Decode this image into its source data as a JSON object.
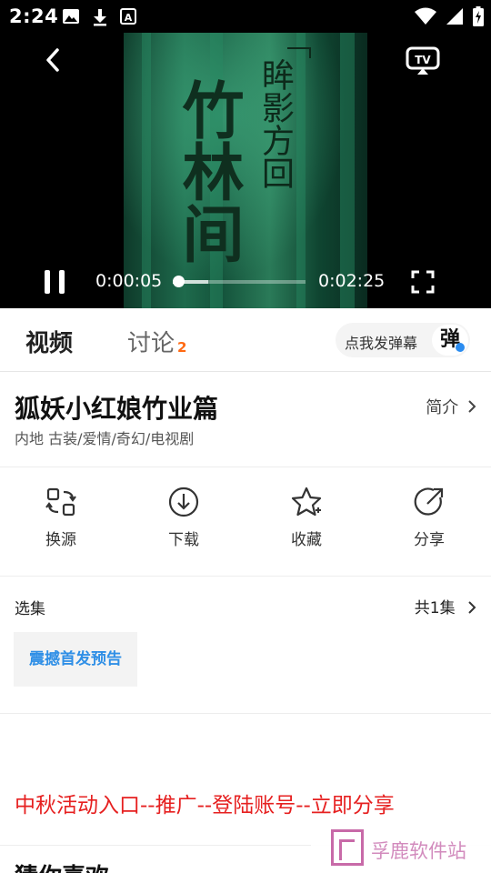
{
  "status_bar": {
    "time": "2:24",
    "left_icons": [
      "image-icon",
      "download-icon",
      "font-icon"
    ],
    "right_icons": [
      "wifi-icon",
      "signal-icon",
      "battery-charging-icon"
    ]
  },
  "player": {
    "poster": {
      "main_text": "竹林间",
      "side_text": "眸影方回"
    },
    "current_time": "0:00:05",
    "duration": "0:02:25",
    "progress": 0.04,
    "buffered": 0.27,
    "icons": {
      "back": "back-chevron-icon",
      "cast": "tv-cast-icon",
      "pause": "pause-icon",
      "fullscreen": "fullscreen-icon"
    }
  },
  "tabs": {
    "video": "视频",
    "discuss": "讨论",
    "discuss_count": "2",
    "danmu_label": "点我发弹幕",
    "danmu_icon": "弹"
  },
  "show": {
    "title": "狐妖小红娘竹业篇",
    "meta": "内地 古装/爱情/奇幻/电视剧",
    "intro_link": "简介"
  },
  "actions": [
    {
      "label": "换源",
      "icon": "switch-source-icon"
    },
    {
      "label": "下载",
      "icon": "download-icon"
    },
    {
      "label": "收藏",
      "icon": "star-icon"
    },
    {
      "label": "分享",
      "icon": "share-icon"
    }
  ],
  "episodes": {
    "title": "选集",
    "count": "共1集",
    "items": [
      "震撼首发预告"
    ]
  },
  "promo_text": "中秋活动入口--推广--登陆账号--立即分享",
  "guess_title": "猜你喜欢",
  "watermark": "孚鹿软件站",
  "colors": {
    "accent_blue": "#2f8fe6",
    "badge_orange": "#ff6a13",
    "promo_red": "#e62020"
  }
}
